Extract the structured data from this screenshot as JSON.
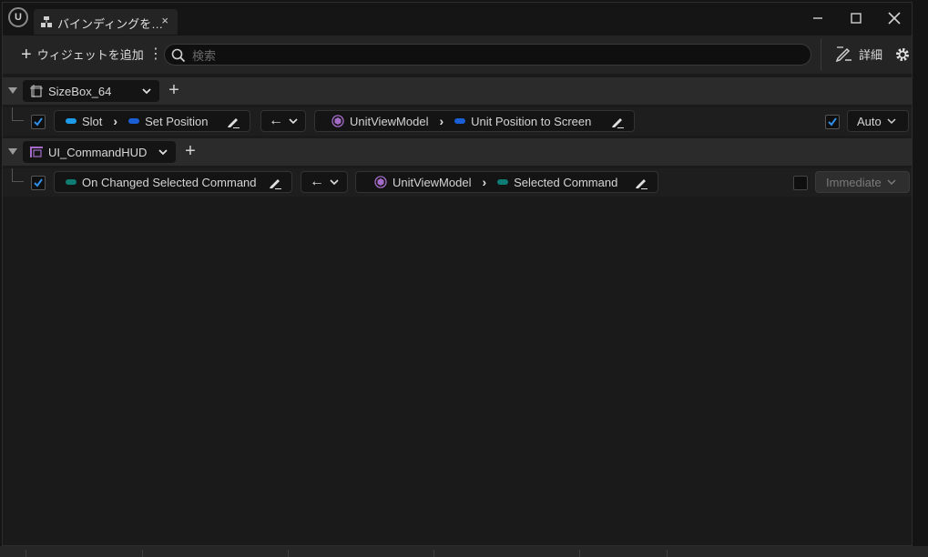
{
  "window": {
    "tab_title": "バインディングを…",
    "tab_close": "×"
  },
  "toolbar": {
    "add_widget_label": "ウィジェットを追加",
    "search_placeholder": "検索",
    "details_label": "詳細"
  },
  "groups": [
    {
      "name": "SizeBox_64",
      "icon": "sizebox-icon",
      "bindings": [
        {
          "checked": true,
          "widget_path": [
            "Slot",
            "Set Position"
          ],
          "widget_pill_colors": [
            "#1e9be8",
            "#1a5fd6"
          ],
          "direction": "←",
          "source_path": [
            "UnitViewModel",
            "Unit Position to Screen"
          ],
          "source_pill_color": "#1a5fd6",
          "mode_checked": true,
          "mode": "Auto",
          "mode_disabled": false
        }
      ]
    },
    {
      "name": "UI_CommandHUD",
      "icon": "user-widget-icon",
      "bindings": [
        {
          "checked": true,
          "widget_path": [
            "On Changed Selected Command"
          ],
          "widget_pill_colors": [
            "#0f7c73"
          ],
          "direction": "←",
          "source_path": [
            "UnitViewModel",
            "Selected Command"
          ],
          "source_pill_color": "#0f7c73",
          "mode_checked": false,
          "mode": "Immediate",
          "mode_disabled": true
        }
      ]
    }
  ],
  "colors": {
    "accent_blue": "#1e9be8",
    "checkbox_check": "#2f8fe8",
    "viewmodel_purple": "#a46cc8"
  }
}
